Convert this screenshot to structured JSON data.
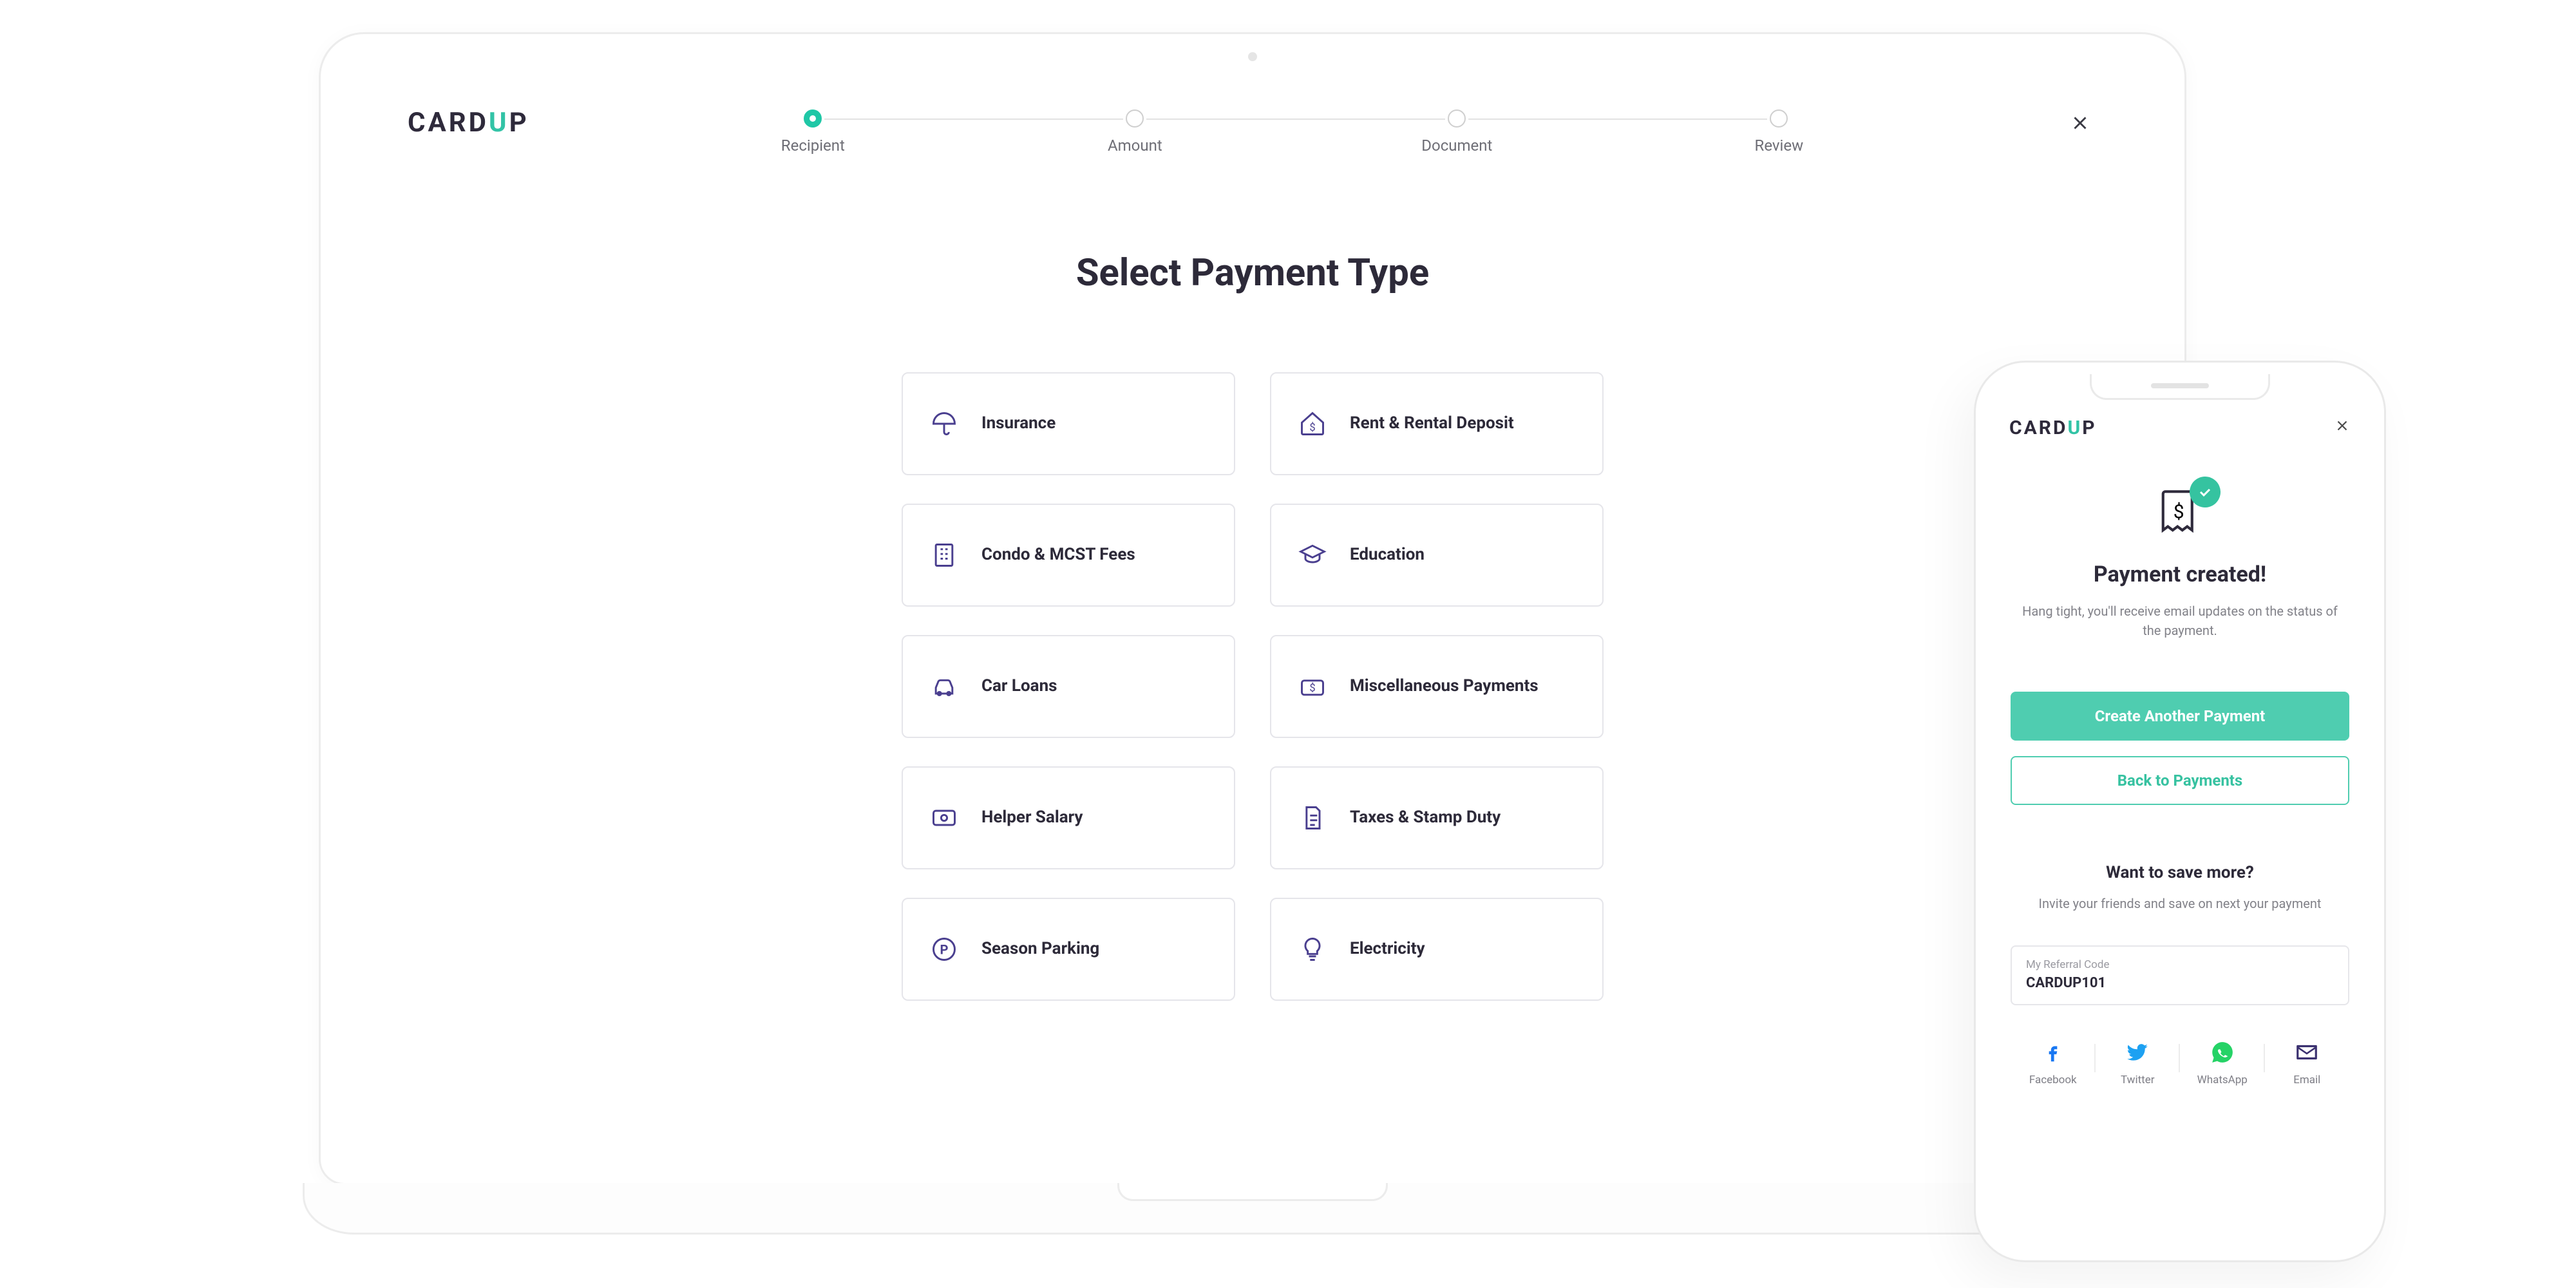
{
  "brand": {
    "name": "CARDUP"
  },
  "stepper": {
    "steps": [
      "Recipient",
      "Amount",
      "Document",
      "Review"
    ],
    "active_index": 0
  },
  "page_title": "Select Payment Type",
  "payment_types": [
    {
      "icon": "umbrella-icon",
      "label": "Insurance"
    },
    {
      "icon": "home-dollar-icon",
      "label": "Rent & Rental Deposit"
    },
    {
      "icon": "building-icon",
      "label": "Condo & MCST Fees"
    },
    {
      "icon": "graduation-cap-icon",
      "label": "Education"
    },
    {
      "icon": "car-icon",
      "label": "Car Loans"
    },
    {
      "icon": "money-misc-icon",
      "label": "Miscellaneous Payments"
    },
    {
      "icon": "cash-icon",
      "label": "Helper Salary"
    },
    {
      "icon": "document-tax-icon",
      "label": "Taxes & Stamp Duty"
    },
    {
      "icon": "parking-icon",
      "label": "Season Parking"
    },
    {
      "icon": "lightbulb-icon",
      "label": "Electricity"
    }
  ],
  "phone": {
    "title": "Payment created!",
    "subtitle": "Hang tight, you'll receive email updates on the status of the payment.",
    "primary_btn": "Create Another Payment",
    "secondary_btn": "Back to Payments",
    "save_title": "Want to save more?",
    "save_sub": "Invite your friends and save on next your payment",
    "ref_label": "My Referral Code",
    "ref_code": "CARDUP101",
    "share": [
      {
        "name": "Facebook",
        "icon": "facebook-icon",
        "color": "#1877F2"
      },
      {
        "name": "Twitter",
        "icon": "twitter-icon",
        "color": "#1DA1F2"
      },
      {
        "name": "WhatsApp",
        "icon": "whatsapp-icon",
        "color": "#25D366"
      },
      {
        "name": "Email",
        "icon": "email-icon",
        "color": "#3b3170"
      }
    ]
  }
}
